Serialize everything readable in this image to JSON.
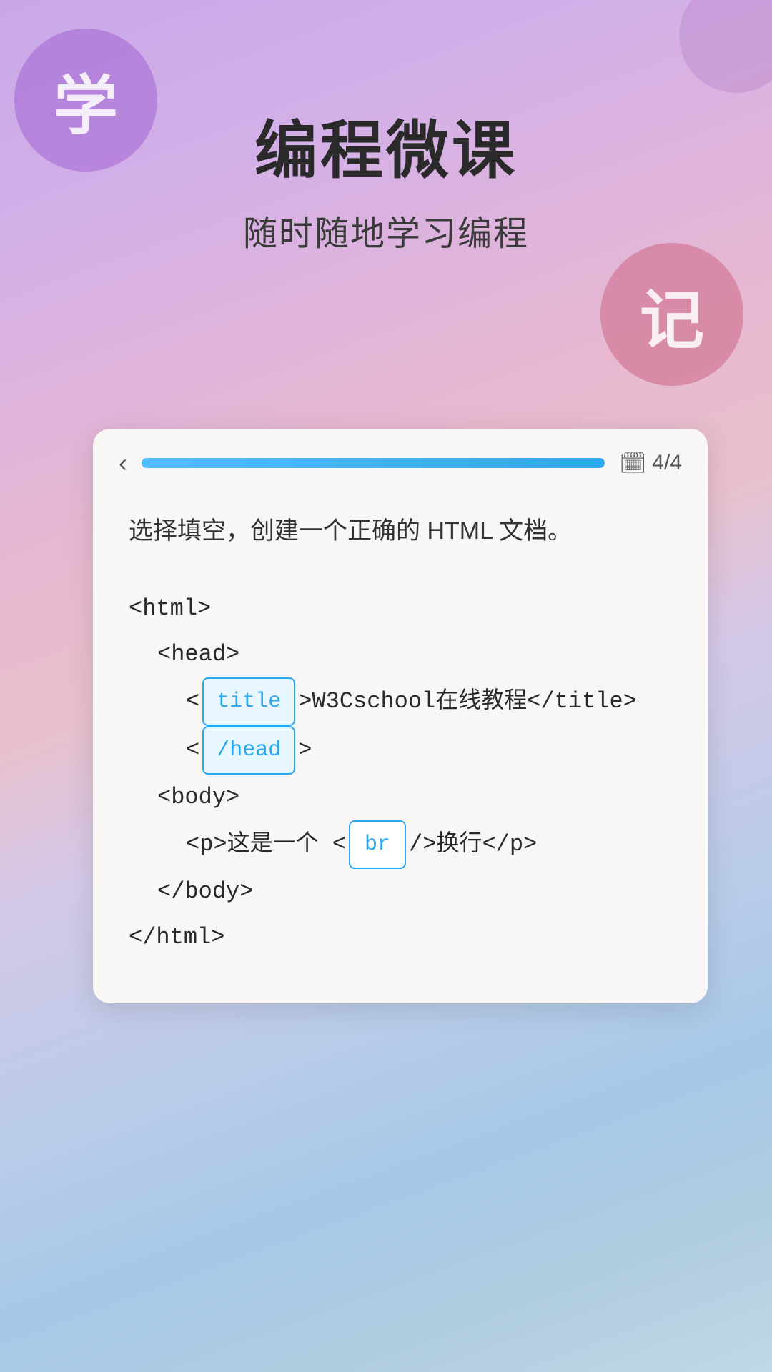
{
  "background": {
    "gradient_desc": "lavender to pink to blue gradient"
  },
  "decorative": {
    "circle_xue_label": "学",
    "circle_ji_label": "记"
  },
  "header": {
    "main_title": "编程微课",
    "sub_title": "随时随地学习编程"
  },
  "card": {
    "back_button_label": "‹",
    "progress_percent": 100,
    "page_count_label": "4/4",
    "calendar_icon": "📅",
    "question": "选择填空，创建一个正确的 HTML 文档。",
    "code_lines": [
      {
        "id": "line1",
        "indent": 0,
        "parts": [
          {
            "type": "text",
            "value": "<html>"
          }
        ]
      },
      {
        "id": "line2",
        "indent": 1,
        "parts": [
          {
            "type": "text",
            "value": "<head>"
          }
        ]
      },
      {
        "id": "line3",
        "indent": 2,
        "parts": [
          {
            "type": "text",
            "value": "<"
          },
          {
            "type": "chip",
            "value": "title",
            "selected": true
          },
          {
            "type": "text",
            "value": ">W3Cschool在线教程</title>"
          }
        ]
      },
      {
        "id": "line4",
        "indent": 2,
        "parts": [
          {
            "type": "text",
            "value": "<"
          },
          {
            "type": "chip",
            "value": "/head",
            "selected": true
          },
          {
            "type": "text",
            "value": ">"
          }
        ]
      },
      {
        "id": "line5",
        "indent": 1,
        "parts": [
          {
            "type": "text",
            "value": "<body>"
          }
        ]
      },
      {
        "id": "line6",
        "indent": 2,
        "parts": [
          {
            "type": "text",
            "value": "<p>这是一个 <"
          },
          {
            "type": "chip",
            "value": "br",
            "selected": false
          },
          {
            "type": "text",
            "value": "/>换行</p>"
          }
        ]
      },
      {
        "id": "line7",
        "indent": 1,
        "parts": [
          {
            "type": "text",
            "value": "</body>"
          }
        ]
      },
      {
        "id": "line8",
        "indent": 0,
        "parts": [
          {
            "type": "text",
            "value": "</html>"
          }
        ]
      }
    ]
  }
}
